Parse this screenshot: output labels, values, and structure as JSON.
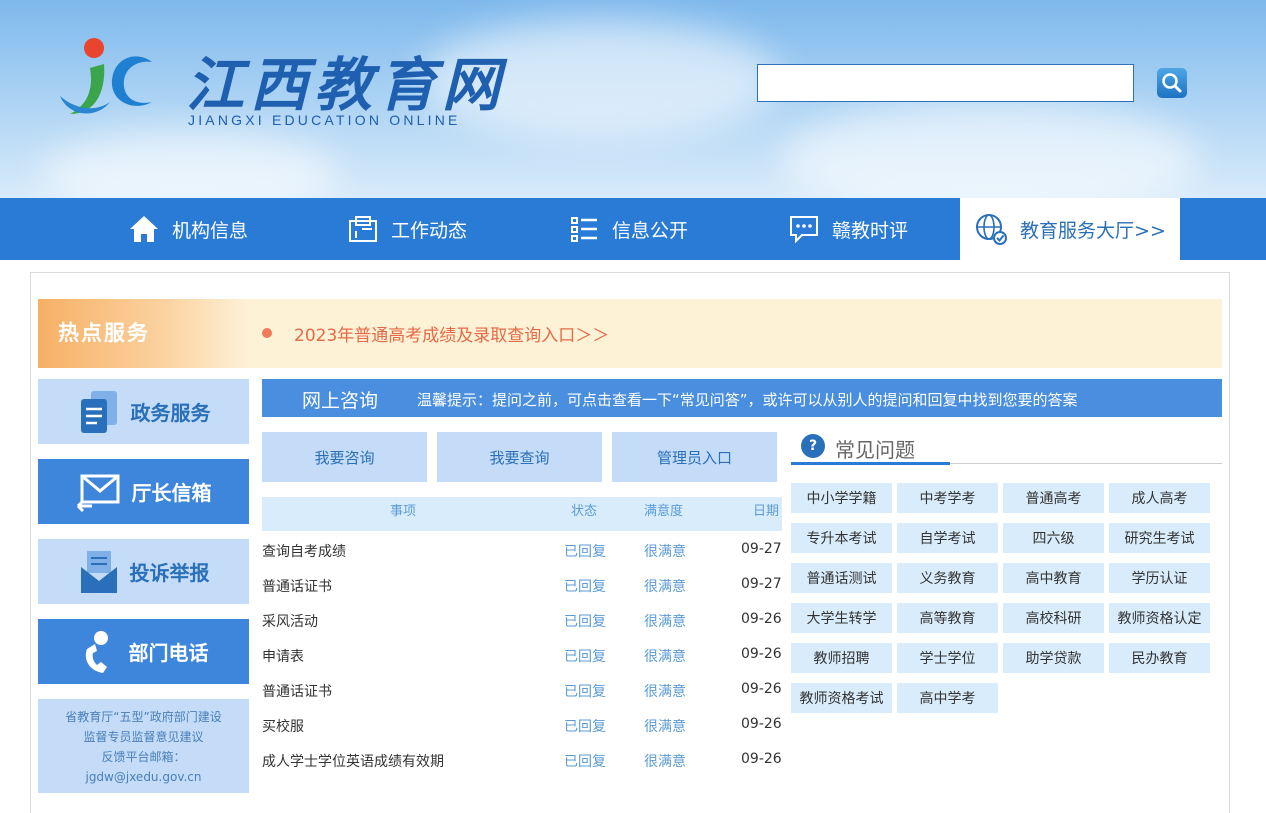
{
  "header": {
    "logo_title": "江西教育网",
    "logo_subtitle": "JIANGXI EDUCATION ONLINE",
    "search": {
      "value": "",
      "placeholder": ""
    }
  },
  "nav": {
    "items": [
      {
        "label": "机构信息",
        "icon": "home-icon"
      },
      {
        "label": "工作动态",
        "icon": "news-icon"
      },
      {
        "label": "信息公开",
        "icon": "list-icon"
      },
      {
        "label": "赣教时评",
        "icon": "comment-icon"
      },
      {
        "label": "教育服务大厅>>",
        "icon": "globe-icon"
      }
    ]
  },
  "hot": {
    "label": "热点服务",
    "link": "2023年普通高考成绩及录取查询入口＞＞"
  },
  "sidebar": {
    "buttons": [
      {
        "label": "政务服务",
        "icon": "document-icon"
      },
      {
        "label": "厅长信箱",
        "icon": "mail-icon"
      },
      {
        "label": "投诉举报",
        "icon": "report-icon"
      },
      {
        "label": "部门电话",
        "icon": "phone-icon"
      }
    ],
    "note": {
      "line1": "省教育厅“五型”政府部门建设",
      "line2": "监督专员监督意见建议",
      "line3": "反馈平台邮箱：",
      "line4": "jgdw@jxedu.gov.cn"
    }
  },
  "consult": {
    "title": "网上咨询",
    "tip": "温馨提示：提问之前，可点击查看一下“常见问答”，或许可以从别人的提问和回复中找到您要的答案",
    "buttons": [
      "我要咨询",
      "我要查询",
      "管理员入口"
    ],
    "columns": {
      "item": "事项",
      "status": "状态",
      "satisfaction": "满意度",
      "date": "日期"
    },
    "rows": [
      {
        "title": "查询自考成绩",
        "status": "已回复",
        "satisfaction": "很满意",
        "date": "09-27"
      },
      {
        "title": "普通话证书",
        "status": "已回复",
        "satisfaction": "很满意",
        "date": "09-27"
      },
      {
        "title": "采风活动",
        "status": "已回复",
        "satisfaction": "很满意",
        "date": "09-26"
      },
      {
        "title": "申请表",
        "status": "已回复",
        "satisfaction": "很满意",
        "date": "09-26"
      },
      {
        "title": "普通话证书",
        "status": "已回复",
        "satisfaction": "很满意",
        "date": "09-26"
      },
      {
        "title": "买校服",
        "status": "已回复",
        "satisfaction": "很满意",
        "date": "09-26"
      },
      {
        "title": "成人学士学位英语成绩有效期",
        "status": "已回复",
        "satisfaction": "很满意",
        "date": "09-26"
      }
    ]
  },
  "faq": {
    "title": "常见问题",
    "icon": "question-icon",
    "tags": [
      "中小学学籍",
      "中考学考",
      "普通高考",
      "成人高考",
      "专升本考试",
      "自学考试",
      "四六级",
      "研究生考试",
      "普通话测试",
      "义务教育",
      "高中教育",
      "学历认证",
      "大学生转学",
      "高等教育",
      "高校科研",
      "教师资格认定",
      "教师招聘",
      "学士学位",
      "助学贷款",
      "民办教育",
      "教师资格考试",
      "高中学考"
    ]
  },
  "colors": {
    "nav": "#2a7bd5",
    "accent": "#e66a47",
    "light_blue": "#c4dcf7"
  }
}
